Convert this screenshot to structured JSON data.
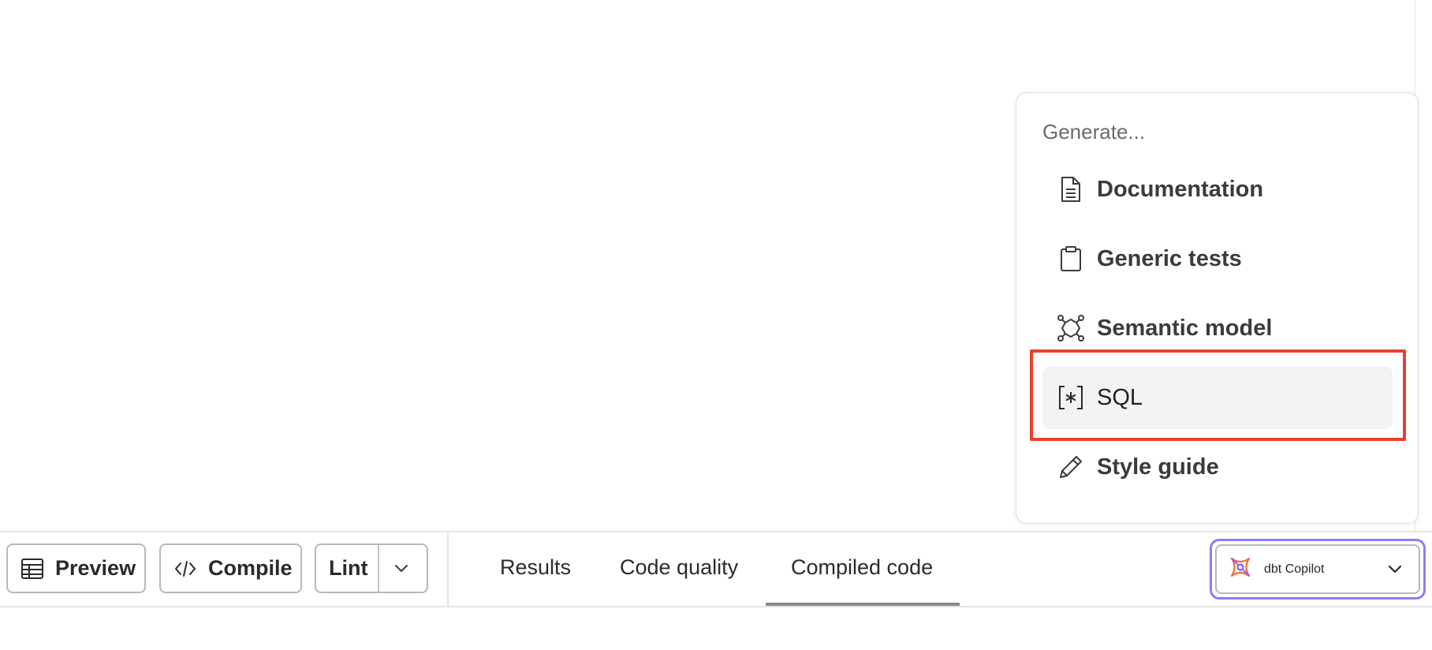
{
  "menu": {
    "heading": "Generate...",
    "items": [
      {
        "label": "Documentation",
        "icon": "document-icon"
      },
      {
        "label": "Generic tests",
        "icon": "clipboard-icon"
      },
      {
        "label": "Semantic model",
        "icon": "semantic-model-icon"
      },
      {
        "label": "SQL",
        "icon": "sql-bracket-icon",
        "selected": true
      },
      {
        "label": "Style guide",
        "icon": "pencil-icon"
      }
    ]
  },
  "toolbar": {
    "preview_label": "Preview",
    "compile_label": "Compile",
    "lint_label": "Lint"
  },
  "tabs": [
    {
      "label": "Results"
    },
    {
      "label": "Code quality"
    },
    {
      "label": "Compiled code",
      "active": true
    }
  ],
  "copilot": {
    "label": "dbt Copilot",
    "accent": "#8f7cf0"
  },
  "colors": {
    "highlight": "#e8412c",
    "selected_bg": "#f3f3f3"
  }
}
